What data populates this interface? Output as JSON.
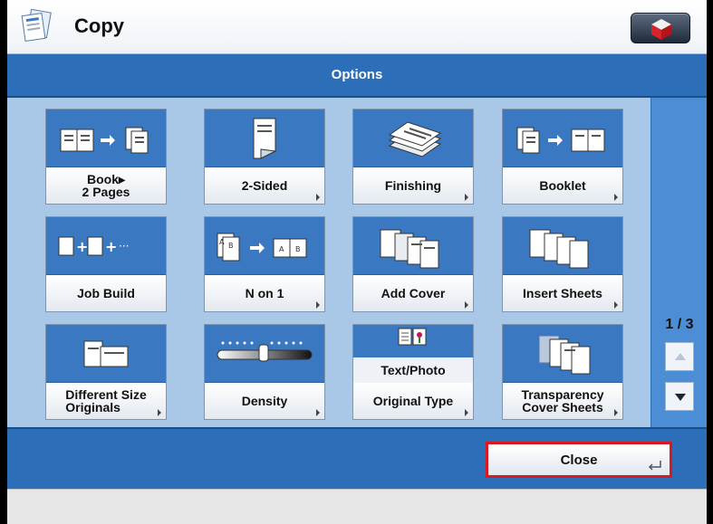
{
  "header": {
    "title": "Copy",
    "app_icon": "copy-app-icon",
    "home_icon": "home-cube-icon"
  },
  "options_bar": {
    "title": "Options"
  },
  "tiles": [
    {
      "label_line1": "Book▸",
      "label_line2": "2 Pages",
      "icon": "book-to-pages-icon",
      "has_arrow": false
    },
    {
      "label_line1": "2-Sided",
      "label_line2": "",
      "icon": "two-sided-icon",
      "has_arrow": true
    },
    {
      "label_line1": "Finishing",
      "label_line2": "",
      "icon": "finishing-stack-icon",
      "has_arrow": true
    },
    {
      "label_line1": "Booklet",
      "label_line2": "",
      "icon": "booklet-icon",
      "has_arrow": true
    },
    {
      "label_line1": "Job Build",
      "label_line2": "",
      "icon": "job-build-icon",
      "has_arrow": false
    },
    {
      "label_line1": "N on 1",
      "label_line2": "",
      "icon": "n-on-1-icon",
      "has_arrow": true
    },
    {
      "label_line1": "Add Cover",
      "label_line2": "",
      "icon": "add-cover-icon",
      "has_arrow": true
    },
    {
      "label_line1": "Insert Sheets",
      "label_line2": "",
      "icon": "insert-sheets-icon",
      "has_arrow": true
    },
    {
      "label_line1": "Different Size",
      "label_line2": "Originals",
      "icon": "different-size-originals-icon",
      "has_arrow": true
    },
    {
      "label_line1": "Density",
      "label_line2": "",
      "icon": "density-slider-icon",
      "has_arrow": true
    },
    {
      "label_line1": "Original Type",
      "label_line2": "",
      "icon": "original-type-icon",
      "sub_label": "Text/Photo",
      "has_arrow": true
    },
    {
      "label_line1": "Transparency",
      "label_line2": "Cover Sheets",
      "icon": "transparency-cover-sheets-icon",
      "has_arrow": true
    }
  ],
  "pager": {
    "indicator": "1 / 3",
    "up_icon": "scroll-up-icon",
    "down_icon": "scroll-down-icon"
  },
  "footer": {
    "close_label": "Close",
    "close_icon": "enter-return-icon"
  },
  "colors": {
    "header_blue": "#2c6fb8",
    "tile_blue": "#3a78c2",
    "grid_bg": "#a9c8e8",
    "close_border": "#d81920"
  }
}
